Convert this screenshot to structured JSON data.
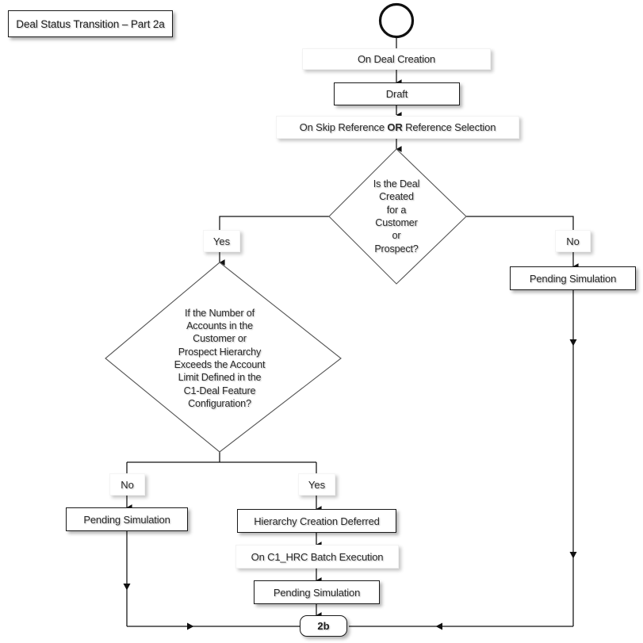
{
  "diagram": {
    "title": "Deal Status Transition – Part 2a",
    "type": "flowchart",
    "stroke_color": "#1a1a1a",
    "diamond_stroke_color": "#4a4a4a",
    "background": "#ffffff"
  },
  "start": {
    "name": "start-circle",
    "shape": "circle"
  },
  "labels": {
    "on_deal_creation": "On Deal Creation",
    "on_skip_reference_prefix": "On Skip Reference ",
    "on_skip_reference_bold": "OR",
    "on_skip_reference_suffix": " Reference Selection",
    "on_batch_execution": "On C1_HRC Batch Execution",
    "yes_1": "Yes",
    "no_1": "No",
    "no_2": "No",
    "yes_2": "Yes"
  },
  "states": {
    "draft": "Draft",
    "pending_simulation_right": "Pending Simulation",
    "pending_simulation_left": "Pending Simulation",
    "hierarchy_creation_deferred": "Hierarchy Creation Deferred",
    "pending_simulation_bottom": "Pending Simulation"
  },
  "decisions": {
    "customer_or_prospect": {
      "lines": [
        "Is the Deal",
        "Created",
        "for a",
        "Customer",
        "or",
        "Prospect?"
      ]
    },
    "account_limit": {
      "lines": [
        "If the Number of",
        "Accounts in the",
        "Customer or",
        "Prospect Hierarchy",
        "Exceeds the Account",
        "Limit Defined in the",
        "C1-Deal Feature",
        "Configuration?"
      ]
    }
  },
  "connector": {
    "next_part": "2b"
  }
}
